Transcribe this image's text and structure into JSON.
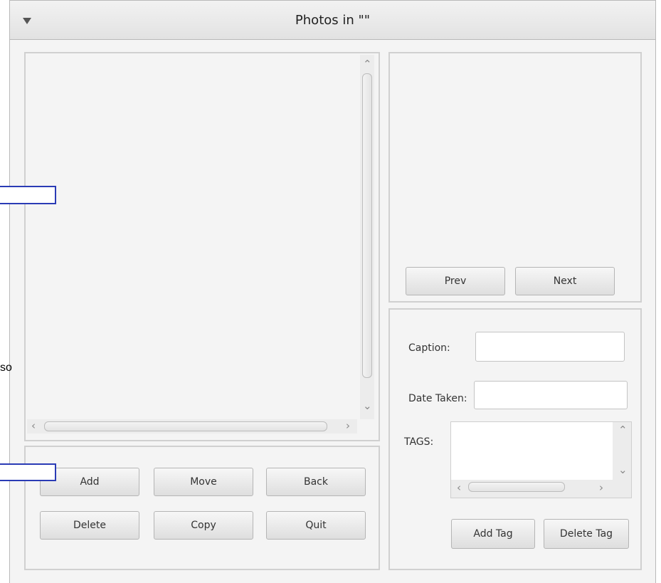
{
  "window": {
    "title": "Photos in \"\""
  },
  "photo_list": {
    "scroll_up": "⌃",
    "scroll_down": "⌄",
    "scroll_left": "‹",
    "scroll_right": "›"
  },
  "viewer": {
    "prev_label": "Prev",
    "next_label": "Next"
  },
  "details": {
    "caption_label": "Caption:",
    "caption_value": "",
    "date_label": "Date Taken:",
    "date_value": "",
    "tags_label": "TAGS:",
    "add_tag_label": "Add Tag",
    "delete_tag_label": "Delete Tag"
  },
  "actions": {
    "add": "Add",
    "move": "Move",
    "back": "Back",
    "delete": "Delete",
    "copy": "Copy",
    "quit": "Quit"
  },
  "overlay": {
    "stray_text": "so"
  }
}
